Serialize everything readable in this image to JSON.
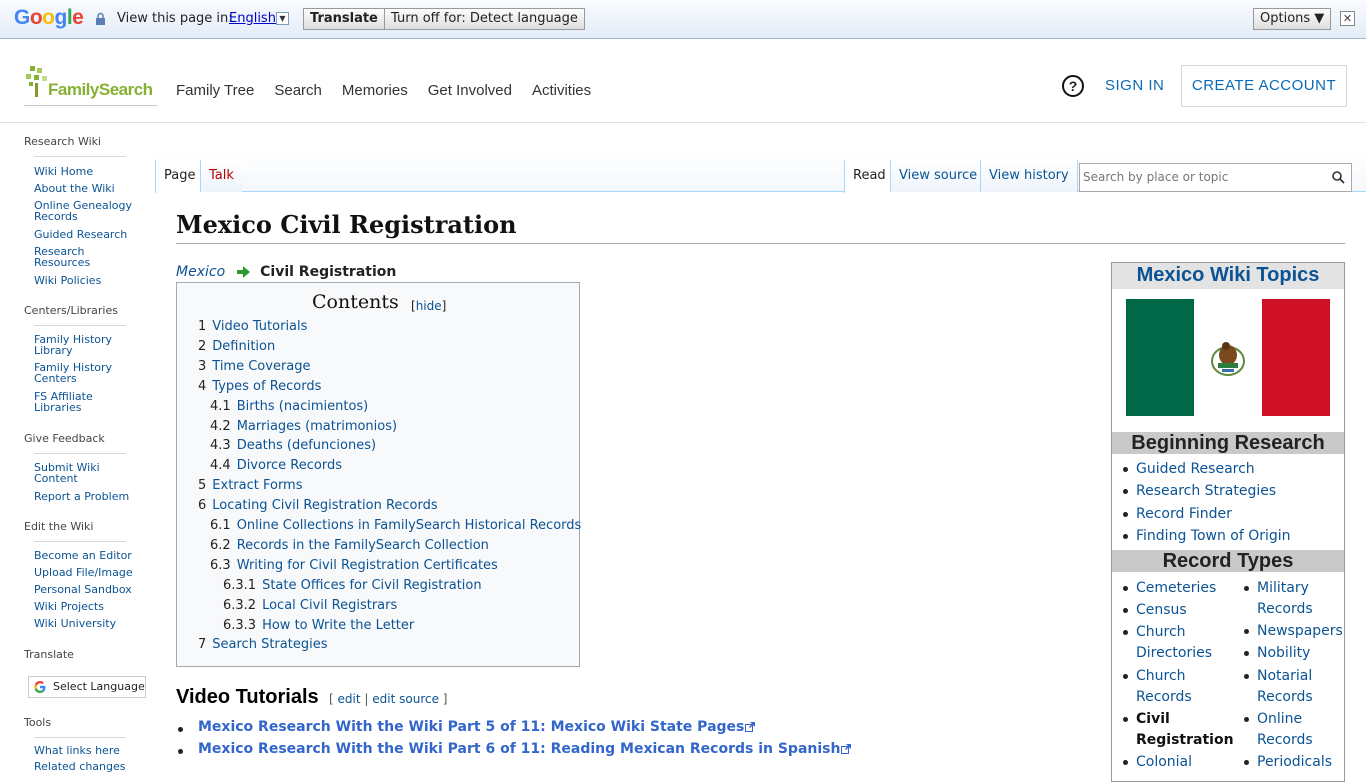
{
  "translate_bar": {
    "view_text": "View this page in:",
    "language": "English",
    "translate_label": "Translate",
    "turn_off_label": "Turn off for: Detect language",
    "options_label": "Options ▼",
    "close_glyph": "✕"
  },
  "header": {
    "logo_text": "FamilySearch",
    "nav": [
      "Family Tree",
      "Search",
      "Memories",
      "Get Involved",
      "Activities"
    ],
    "help_glyph": "?",
    "sign_in": "SIGN IN",
    "create_account": "CREATE ACCOUNT"
  },
  "sidebar": {
    "sections": [
      {
        "heading": "Research Wiki",
        "items": [
          "Wiki Home",
          "About the Wiki",
          "Online Genealogy Records",
          "Guided Research",
          "Research Resources",
          "Wiki Policies"
        ]
      },
      {
        "heading": "Centers/Libraries",
        "items": [
          "Family History Library",
          "Family History Centers",
          "FS Affiliate Libraries"
        ]
      },
      {
        "heading": "Give Feedback",
        "items": [
          "Submit Wiki Content",
          "Report a Problem"
        ]
      },
      {
        "heading": "Edit the Wiki",
        "items": [
          "Become an Editor",
          "Upload File/Image",
          "Personal Sandbox",
          "Wiki Projects",
          "Wiki University"
        ]
      },
      {
        "heading": "Translate",
        "items": []
      },
      {
        "heading": "Tools",
        "items": [
          "What links here",
          "Related changes"
        ]
      }
    ],
    "select_language": "Select Language"
  },
  "tabs": {
    "page": "Page",
    "talk": "Talk",
    "read": "Read",
    "view_source": "View source",
    "view_history": "View history",
    "search_placeholder": "Search by place or topic"
  },
  "article": {
    "title": "Mexico Civil Registration",
    "breadcrumb_parent": "Mexico",
    "breadcrumb_current": "Civil Registration",
    "toc_title": "Contents",
    "toc_hide_open": "[",
    "toc_hide": "hide",
    "toc_hide_close": "]",
    "toc": [
      {
        "num": "1",
        "text": "Video Tutorials",
        "level": 1
      },
      {
        "num": "2",
        "text": "Definition",
        "level": 1
      },
      {
        "num": "3",
        "text": "Time Coverage",
        "level": 1
      },
      {
        "num": "4",
        "text": "Types of Records",
        "level": 1
      },
      {
        "num": "4.1",
        "text": "Births (nacimientos)",
        "level": 2
      },
      {
        "num": "4.2",
        "text": "Marriages (matrimonios)",
        "level": 2
      },
      {
        "num": "4.3",
        "text": "Deaths (defunciones)",
        "level": 2
      },
      {
        "num": "4.4",
        "text": "Divorce Records",
        "level": 2
      },
      {
        "num": "5",
        "text": "Extract Forms",
        "level": 1
      },
      {
        "num": "6",
        "text": "Locating Civil Registration Records",
        "level": 1
      },
      {
        "num": "6.1",
        "text": "Online Collections in FamilySearch Historical Records",
        "level": 2
      },
      {
        "num": "6.2",
        "text": "Records in the FamilySearch Collection",
        "level": 2
      },
      {
        "num": "6.3",
        "text": "Writing for Civil Registration Certificates",
        "level": 2
      },
      {
        "num": "6.3.1",
        "text": "State Offices for Civil Registration",
        "level": 3
      },
      {
        "num": "6.3.2",
        "text": "Local Civil Registrars",
        "level": 3
      },
      {
        "num": "6.3.3",
        "text": "How to Write the Letter",
        "level": 3
      },
      {
        "num": "7",
        "text": "Search Strategies",
        "level": 1
      }
    ],
    "section_heading": "Video Tutorials",
    "edit_open": "[",
    "edit": "edit",
    "edit_sep": "|",
    "edit_source": "edit source",
    "edit_close": "]",
    "video_links": [
      "Mexico Research With the Wiki Part 5 of 11: Mexico Wiki State Pages",
      "Mexico Research With the Wiki Part 6 of 11: Reading Mexican Records in Spanish"
    ]
  },
  "infobox": {
    "title": "Mexico Wiki Topics",
    "beginning_heading": "Beginning Research",
    "beginning_items": [
      "Guided Research",
      "Research Strategies",
      "Record Finder",
      "Finding Town of Origin"
    ],
    "record_types_heading": "Record Types",
    "col1": [
      "Cemeteries",
      "Census",
      "Church\nDirectories",
      "Church\nRecords",
      "Civil\nRegistration",
      "Colonial"
    ],
    "col2": [
      "Military\nRecords",
      "Newspapers",
      "Nobility",
      "Notarial\nRecords",
      "Online\nRecords",
      "Periodicals"
    ]
  },
  "colors": {
    "link": "#0b5394",
    "flag_green": "#006847",
    "flag_red": "#ce1126",
    "logo_green": "#87b134"
  }
}
